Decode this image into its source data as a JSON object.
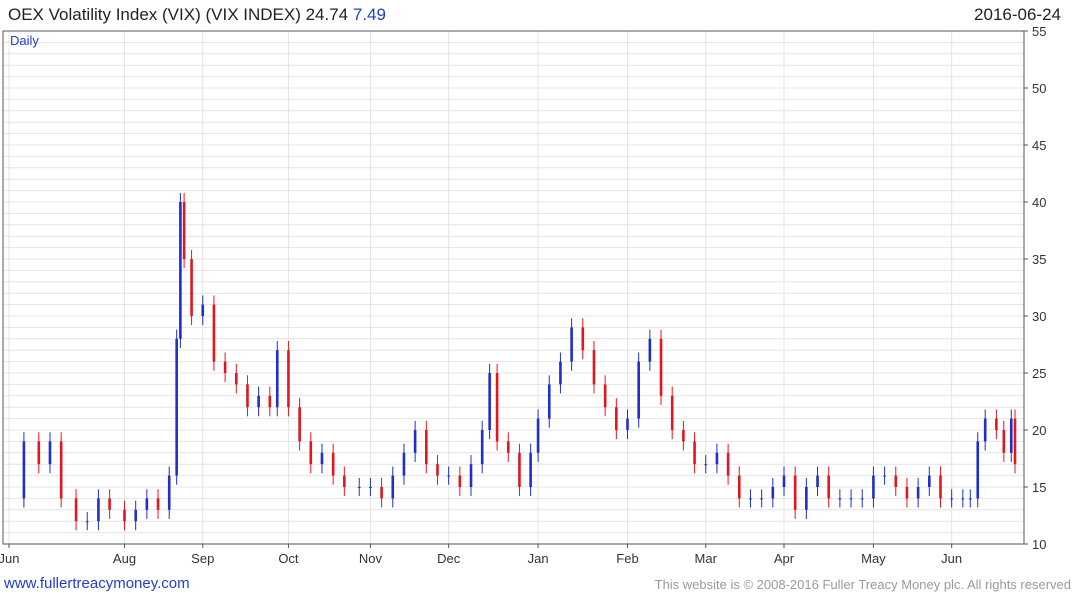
{
  "header": {
    "title": "OEX Volatility Index (VIX) (VIX INDEX) 24.74",
    "change": "7.49",
    "date": "2016-06-24",
    "period_label": "Daily"
  },
  "footer": {
    "url_text": "www.fullertreacymoney.com",
    "copyright": "This website is © 2008-2016 Fuller Treacy Money plc. All rights reserved"
  },
  "colors": {
    "up": "#1f2fcc",
    "down": "#e0181e",
    "grid": "#e4e4e4",
    "axis": "#555555",
    "brand": "#1f3fd0"
  },
  "chart_data": {
    "type": "candlestick",
    "title": "OEX Volatility Index (VIX) (VIX INDEX)",
    "last": 24.74,
    "change": 7.49,
    "ylim": [
      10,
      55
    ],
    "y_ticks": [
      10,
      15,
      20,
      25,
      30,
      35,
      40,
      45,
      50,
      55
    ],
    "x_ticks": [
      "Jun",
      "Aug",
      "Sep",
      "Oct",
      "Nov",
      "Dec",
      "Jan",
      "Feb",
      "Mar",
      "Apr",
      "May",
      "Jun"
    ],
    "grid": true,
    "y_axis_side": "right",
    "close_series": [
      {
        "month": "Jun",
        "x": 0,
        "y": 14
      },
      {
        "month": "Jun",
        "x": 4,
        "y": 19
      },
      {
        "month": "Jun",
        "x": 8,
        "y": 17
      },
      {
        "month": "Jun",
        "x": 11,
        "y": 19
      },
      {
        "month": "Jul",
        "x": 14,
        "y": 14
      },
      {
        "month": "Jul",
        "x": 18,
        "y": 12
      },
      {
        "month": "Jul",
        "x": 21,
        "y": 12
      },
      {
        "month": "Jul",
        "x": 24,
        "y": 14
      },
      {
        "month": "Jul",
        "x": 27,
        "y": 13
      },
      {
        "month": "Aug",
        "x": 31,
        "y": 12
      },
      {
        "month": "Aug",
        "x": 34,
        "y": 13
      },
      {
        "month": "Aug",
        "x": 37,
        "y": 14
      },
      {
        "month": "Aug",
        "x": 40,
        "y": 13
      },
      {
        "month": "Aug",
        "x": 43,
        "y": 16
      },
      {
        "month": "Aug",
        "x": 45,
        "y": 28
      },
      {
        "month": "Aug",
        "x": 46,
        "y": 40
      },
      {
        "month": "Aug",
        "x": 47,
        "y": 35
      },
      {
        "month": "Aug",
        "x": 49,
        "y": 30
      },
      {
        "month": "Sep",
        "x": 52,
        "y": 31
      },
      {
        "month": "Sep",
        "x": 55,
        "y": 26
      },
      {
        "month": "Sep",
        "x": 58,
        "y": 25
      },
      {
        "month": "Sep",
        "x": 61,
        "y": 24
      },
      {
        "month": "Sep",
        "x": 64,
        "y": 22
      },
      {
        "month": "Sep",
        "x": 67,
        "y": 23
      },
      {
        "month": "Sep",
        "x": 70,
        "y": 22
      },
      {
        "month": "Sep",
        "x": 72,
        "y": 27
      },
      {
        "month": "Oct",
        "x": 75,
        "y": 22
      },
      {
        "month": "Oct",
        "x": 78,
        "y": 19
      },
      {
        "month": "Oct",
        "x": 81,
        "y": 17
      },
      {
        "month": "Oct",
        "x": 84,
        "y": 18
      },
      {
        "month": "Oct",
        "x": 87,
        "y": 16
      },
      {
        "month": "Oct",
        "x": 90,
        "y": 15
      },
      {
        "month": "Oct",
        "x": 94,
        "y": 15
      },
      {
        "month": "Nov",
        "x": 97,
        "y": 15
      },
      {
        "month": "Nov",
        "x": 100,
        "y": 14
      },
      {
        "month": "Nov",
        "x": 103,
        "y": 16
      },
      {
        "month": "Nov",
        "x": 106,
        "y": 18
      },
      {
        "month": "Nov",
        "x": 109,
        "y": 20
      },
      {
        "month": "Nov",
        "x": 112,
        "y": 17
      },
      {
        "month": "Nov",
        "x": 115,
        "y": 16
      },
      {
        "month": "Dec",
        "x": 118,
        "y": 16
      },
      {
        "month": "Dec",
        "x": 121,
        "y": 15
      },
      {
        "month": "Dec",
        "x": 124,
        "y": 17
      },
      {
        "month": "Dec",
        "x": 127,
        "y": 20
      },
      {
        "month": "Dec",
        "x": 129,
        "y": 25
      },
      {
        "month": "Dec",
        "x": 131,
        "y": 19
      },
      {
        "month": "Dec",
        "x": 134,
        "y": 18
      },
      {
        "month": "Dec",
        "x": 137,
        "y": 15
      },
      {
        "month": "Dec",
        "x": 140,
        "y": 18
      },
      {
        "month": "Jan",
        "x": 142,
        "y": 21
      },
      {
        "month": "Jan",
        "x": 145,
        "y": 24
      },
      {
        "month": "Jan",
        "x": 148,
        "y": 26
      },
      {
        "month": "Jan",
        "x": 151,
        "y": 29
      },
      {
        "month": "Jan",
        "x": 154,
        "y": 27
      },
      {
        "month": "Jan",
        "x": 157,
        "y": 24
      },
      {
        "month": "Jan",
        "x": 160,
        "y": 22
      },
      {
        "month": "Jan",
        "x": 163,
        "y": 20
      },
      {
        "month": "Feb",
        "x": 166,
        "y": 21
      },
      {
        "month": "Feb",
        "x": 169,
        "y": 26
      },
      {
        "month": "Feb",
        "x": 172,
        "y": 28
      },
      {
        "month": "Feb",
        "x": 175,
        "y": 23
      },
      {
        "month": "Feb",
        "x": 178,
        "y": 20
      },
      {
        "month": "Feb",
        "x": 181,
        "y": 19
      },
      {
        "month": "Feb",
        "x": 184,
        "y": 17
      },
      {
        "month": "Mar",
        "x": 187,
        "y": 17
      },
      {
        "month": "Mar",
        "x": 190,
        "y": 18
      },
      {
        "month": "Mar",
        "x": 193,
        "y": 16
      },
      {
        "month": "Mar",
        "x": 196,
        "y": 14
      },
      {
        "month": "Mar",
        "x": 199,
        "y": 14
      },
      {
        "month": "Mar",
        "x": 202,
        "y": 14
      },
      {
        "month": "Mar",
        "x": 205,
        "y": 15
      },
      {
        "month": "Apr",
        "x": 208,
        "y": 16
      },
      {
        "month": "Apr",
        "x": 211,
        "y": 13
      },
      {
        "month": "Apr",
        "x": 214,
        "y": 15
      },
      {
        "month": "Apr",
        "x": 217,
        "y": 16
      },
      {
        "month": "Apr",
        "x": 220,
        "y": 14
      },
      {
        "month": "Apr",
        "x": 223,
        "y": 14
      },
      {
        "month": "Apr",
        "x": 226,
        "y": 14
      },
      {
        "month": "Apr",
        "x": 229,
        "y": 14
      },
      {
        "month": "May",
        "x": 232,
        "y": 16
      },
      {
        "month": "May",
        "x": 235,
        "y": 16
      },
      {
        "month": "May",
        "x": 238,
        "y": 15
      },
      {
        "month": "May",
        "x": 241,
        "y": 14
      },
      {
        "month": "May",
        "x": 244,
        "y": 15
      },
      {
        "month": "May",
        "x": 247,
        "y": 16
      },
      {
        "month": "May",
        "x": 250,
        "y": 14
      },
      {
        "month": "Jun",
        "x": 253,
        "y": 14
      },
      {
        "month": "Jun",
        "x": 256,
        "y": 14
      },
      {
        "month": "Jun",
        "x": 258,
        "y": 14
      },
      {
        "month": "Jun",
        "x": 260,
        "y": 19
      },
      {
        "month": "Jun",
        "x": 262,
        "y": 21
      },
      {
        "month": "Jun",
        "x": 265,
        "y": 20
      },
      {
        "month": "Jun",
        "x": 267,
        "y": 18
      },
      {
        "month": "Jun",
        "x": 269,
        "y": 21
      },
      {
        "month": "Jun",
        "x": 270,
        "y": 17
      }
    ]
  }
}
